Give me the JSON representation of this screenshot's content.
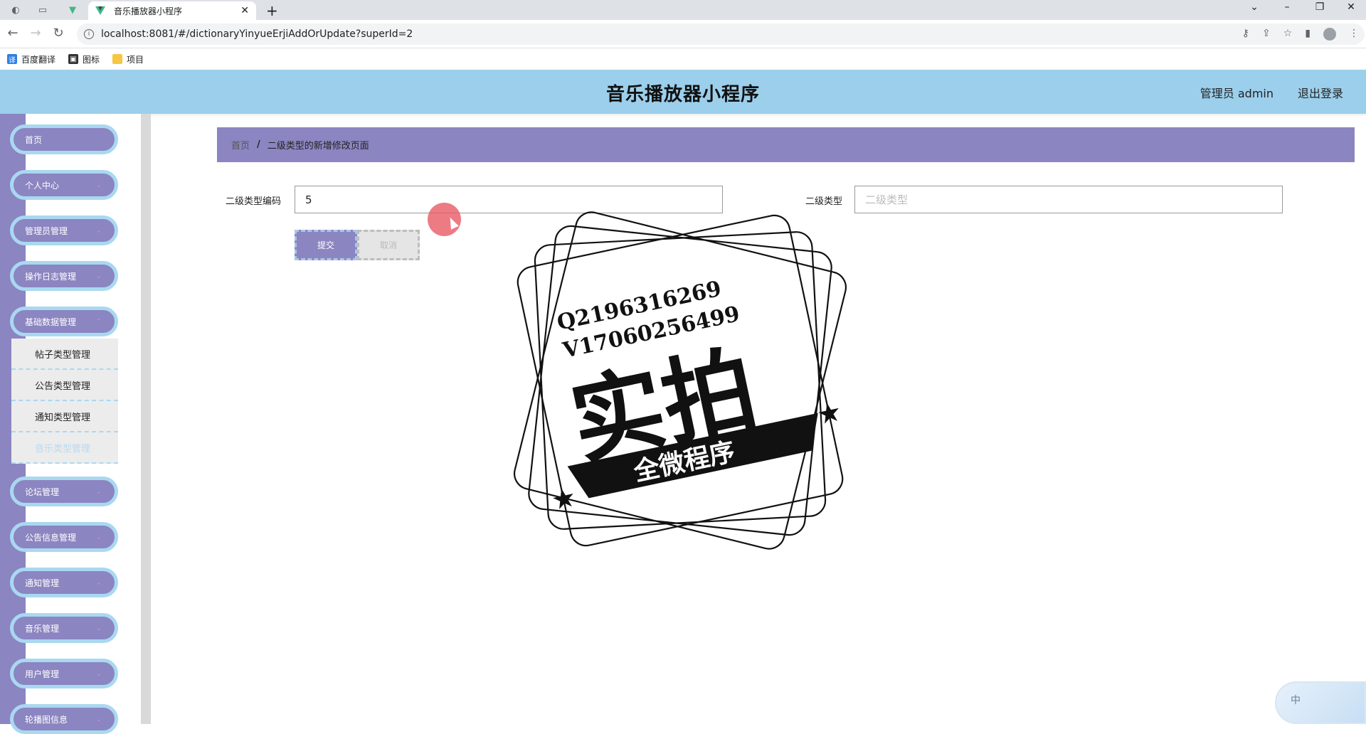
{
  "browser": {
    "tab_title": "音乐播放器小程序",
    "url": "localhost:8081/#/dictionaryYinyueErjiAddOrUpdate?superId=2",
    "bookmarks": [
      "百度翻译",
      "图标",
      "项目"
    ]
  },
  "header": {
    "title": "音乐播放器小程序",
    "user": "管理员 admin",
    "logout": "退出登录"
  },
  "sidebar": {
    "items": [
      {
        "label": "首页"
      },
      {
        "label": "个人中心"
      },
      {
        "label": "管理员管理"
      },
      {
        "label": "操作日志管理"
      },
      {
        "label": "基础数据管理"
      },
      {
        "label": "论坛管理"
      },
      {
        "label": "公告信息管理"
      },
      {
        "label": "通知管理"
      },
      {
        "label": "音乐管理"
      },
      {
        "label": "用户管理"
      },
      {
        "label": "轮播图信息"
      }
    ],
    "submenu": [
      {
        "label": "帖子类型管理"
      },
      {
        "label": "公告类型管理"
      },
      {
        "label": "通知类型管理"
      },
      {
        "label": "音乐类型管理"
      }
    ]
  },
  "breadcrumb": {
    "home": "首页",
    "sep": "/",
    "current": "二级类型的新增修改页面"
  },
  "form": {
    "code_label": "二级类型编码",
    "code_value": "5",
    "type_label": "二级类型",
    "type_placeholder": "二级类型",
    "submit": "提交",
    "cancel": "取消"
  },
  "ime": {
    "label": "中"
  },
  "colors": {
    "header_bg": "#9ccfec",
    "accent": "#8b85c1",
    "menu_border": "#a9d8f1"
  }
}
